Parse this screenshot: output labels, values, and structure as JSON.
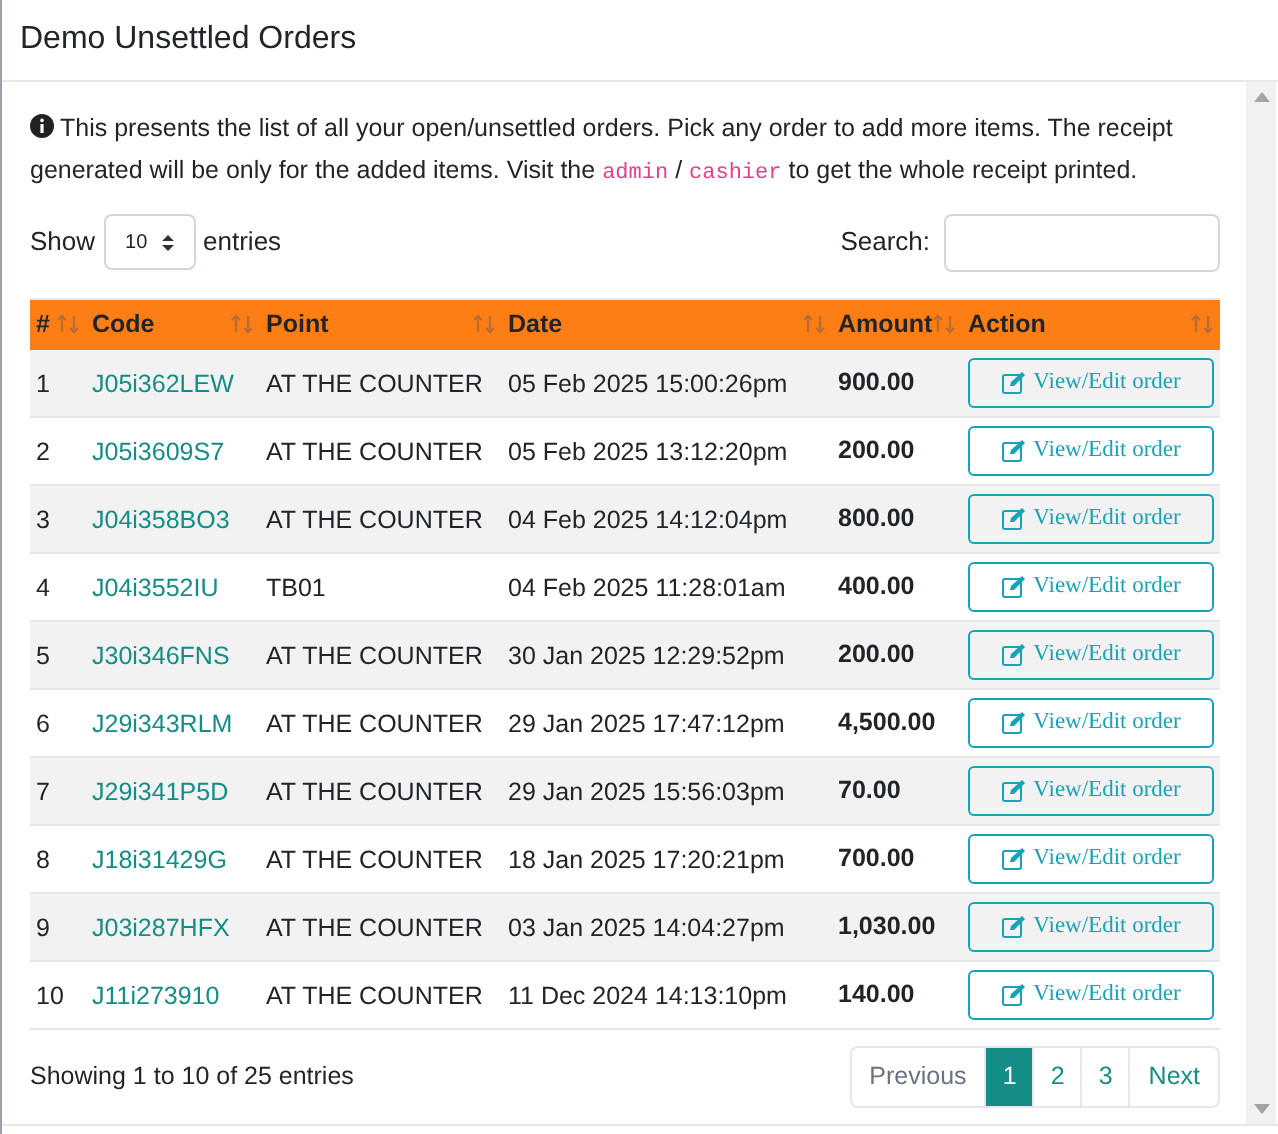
{
  "title": "Demo Unsettled Orders",
  "notice": "This presents the list of all your open/unsettled orders. Pick any order to add more items. The receipt generated will be only for the added items. Visit the ",
  "notice_links": [
    "admin",
    "cashier"
  ],
  "notice_sep": "/",
  "notice_end": " to get the whole receipt printed.",
  "length": {
    "before": "Show",
    "value": "10",
    "after": "entries"
  },
  "search": {
    "label": "Search:"
  },
  "table": {
    "columns": [
      "#",
      "Code",
      "Point",
      "Date",
      "Amount",
      "Action"
    ],
    "rows": [
      {
        "no": "1",
        "code": "J05i362LEW",
        "point": "AT THE COUNTER",
        "date": "05 Feb 2025 15:00:26pm",
        "amount": "900.00",
        "action": "View/Edit order"
      },
      {
        "no": "2",
        "code": "J05i3609S7",
        "point": "AT THE COUNTER",
        "date": "05 Feb 2025 13:12:20pm",
        "amount": "200.00",
        "action": "View/Edit order"
      },
      {
        "no": "3",
        "code": "J04i358BO3",
        "point": "AT THE COUNTER",
        "date": "04 Feb 2025 14:12:04pm",
        "amount": "800.00",
        "action": "View/Edit order"
      },
      {
        "no": "4",
        "code": "J04i3552IU",
        "point": "TB01",
        "date": "04 Feb 2025 11:28:01am",
        "amount": "400.00",
        "action": "View/Edit order"
      },
      {
        "no": "5",
        "code": "J30i346FNS",
        "point": "AT THE COUNTER",
        "date": "30 Jan 2025 12:29:52pm",
        "amount": "200.00",
        "action": "View/Edit order"
      },
      {
        "no": "6",
        "code": "J29i343RLM",
        "point": "AT THE COUNTER",
        "date": "29 Jan 2025 17:47:12pm",
        "amount": "4,500.00",
        "action": "View/Edit order"
      },
      {
        "no": "7",
        "code": "J29i341P5D",
        "point": "AT THE COUNTER",
        "date": "29 Jan 2025 15:56:03pm",
        "amount": "70.00",
        "action": "View/Edit order"
      },
      {
        "no": "8",
        "code": "J18i31429G",
        "point": "AT THE COUNTER",
        "date": "18 Jan 2025 17:20:21pm",
        "amount": "700.00",
        "action": "View/Edit order"
      },
      {
        "no": "9",
        "code": "J03i287HFX",
        "point": "AT THE COUNTER",
        "date": "03 Jan 2025 14:04:27pm",
        "amount": "1,030.00",
        "action": "View/Edit order"
      },
      {
        "no": "10",
        "code": "J11i273910",
        "point": "AT THE COUNTER",
        "date": "11 Dec 2024 14:13:10pm",
        "amount": "140.00",
        "action": "View/Edit order"
      }
    ]
  },
  "info": "Showing 1 to 10 of 25 entries",
  "pagination": [
    {
      "label": "Previous",
      "kind": "nav",
      "disabled": true,
      "selected": false
    },
    {
      "label": "1",
      "kind": "page",
      "disabled": false,
      "selected": true
    },
    {
      "label": "2",
      "kind": "page",
      "disabled": false,
      "selected": false
    },
    {
      "label": "3",
      "kind": "page",
      "disabled": false,
      "selected": false
    },
    {
      "label": "Next",
      "kind": "nav",
      "disabled": false,
      "selected": false
    }
  ]
}
